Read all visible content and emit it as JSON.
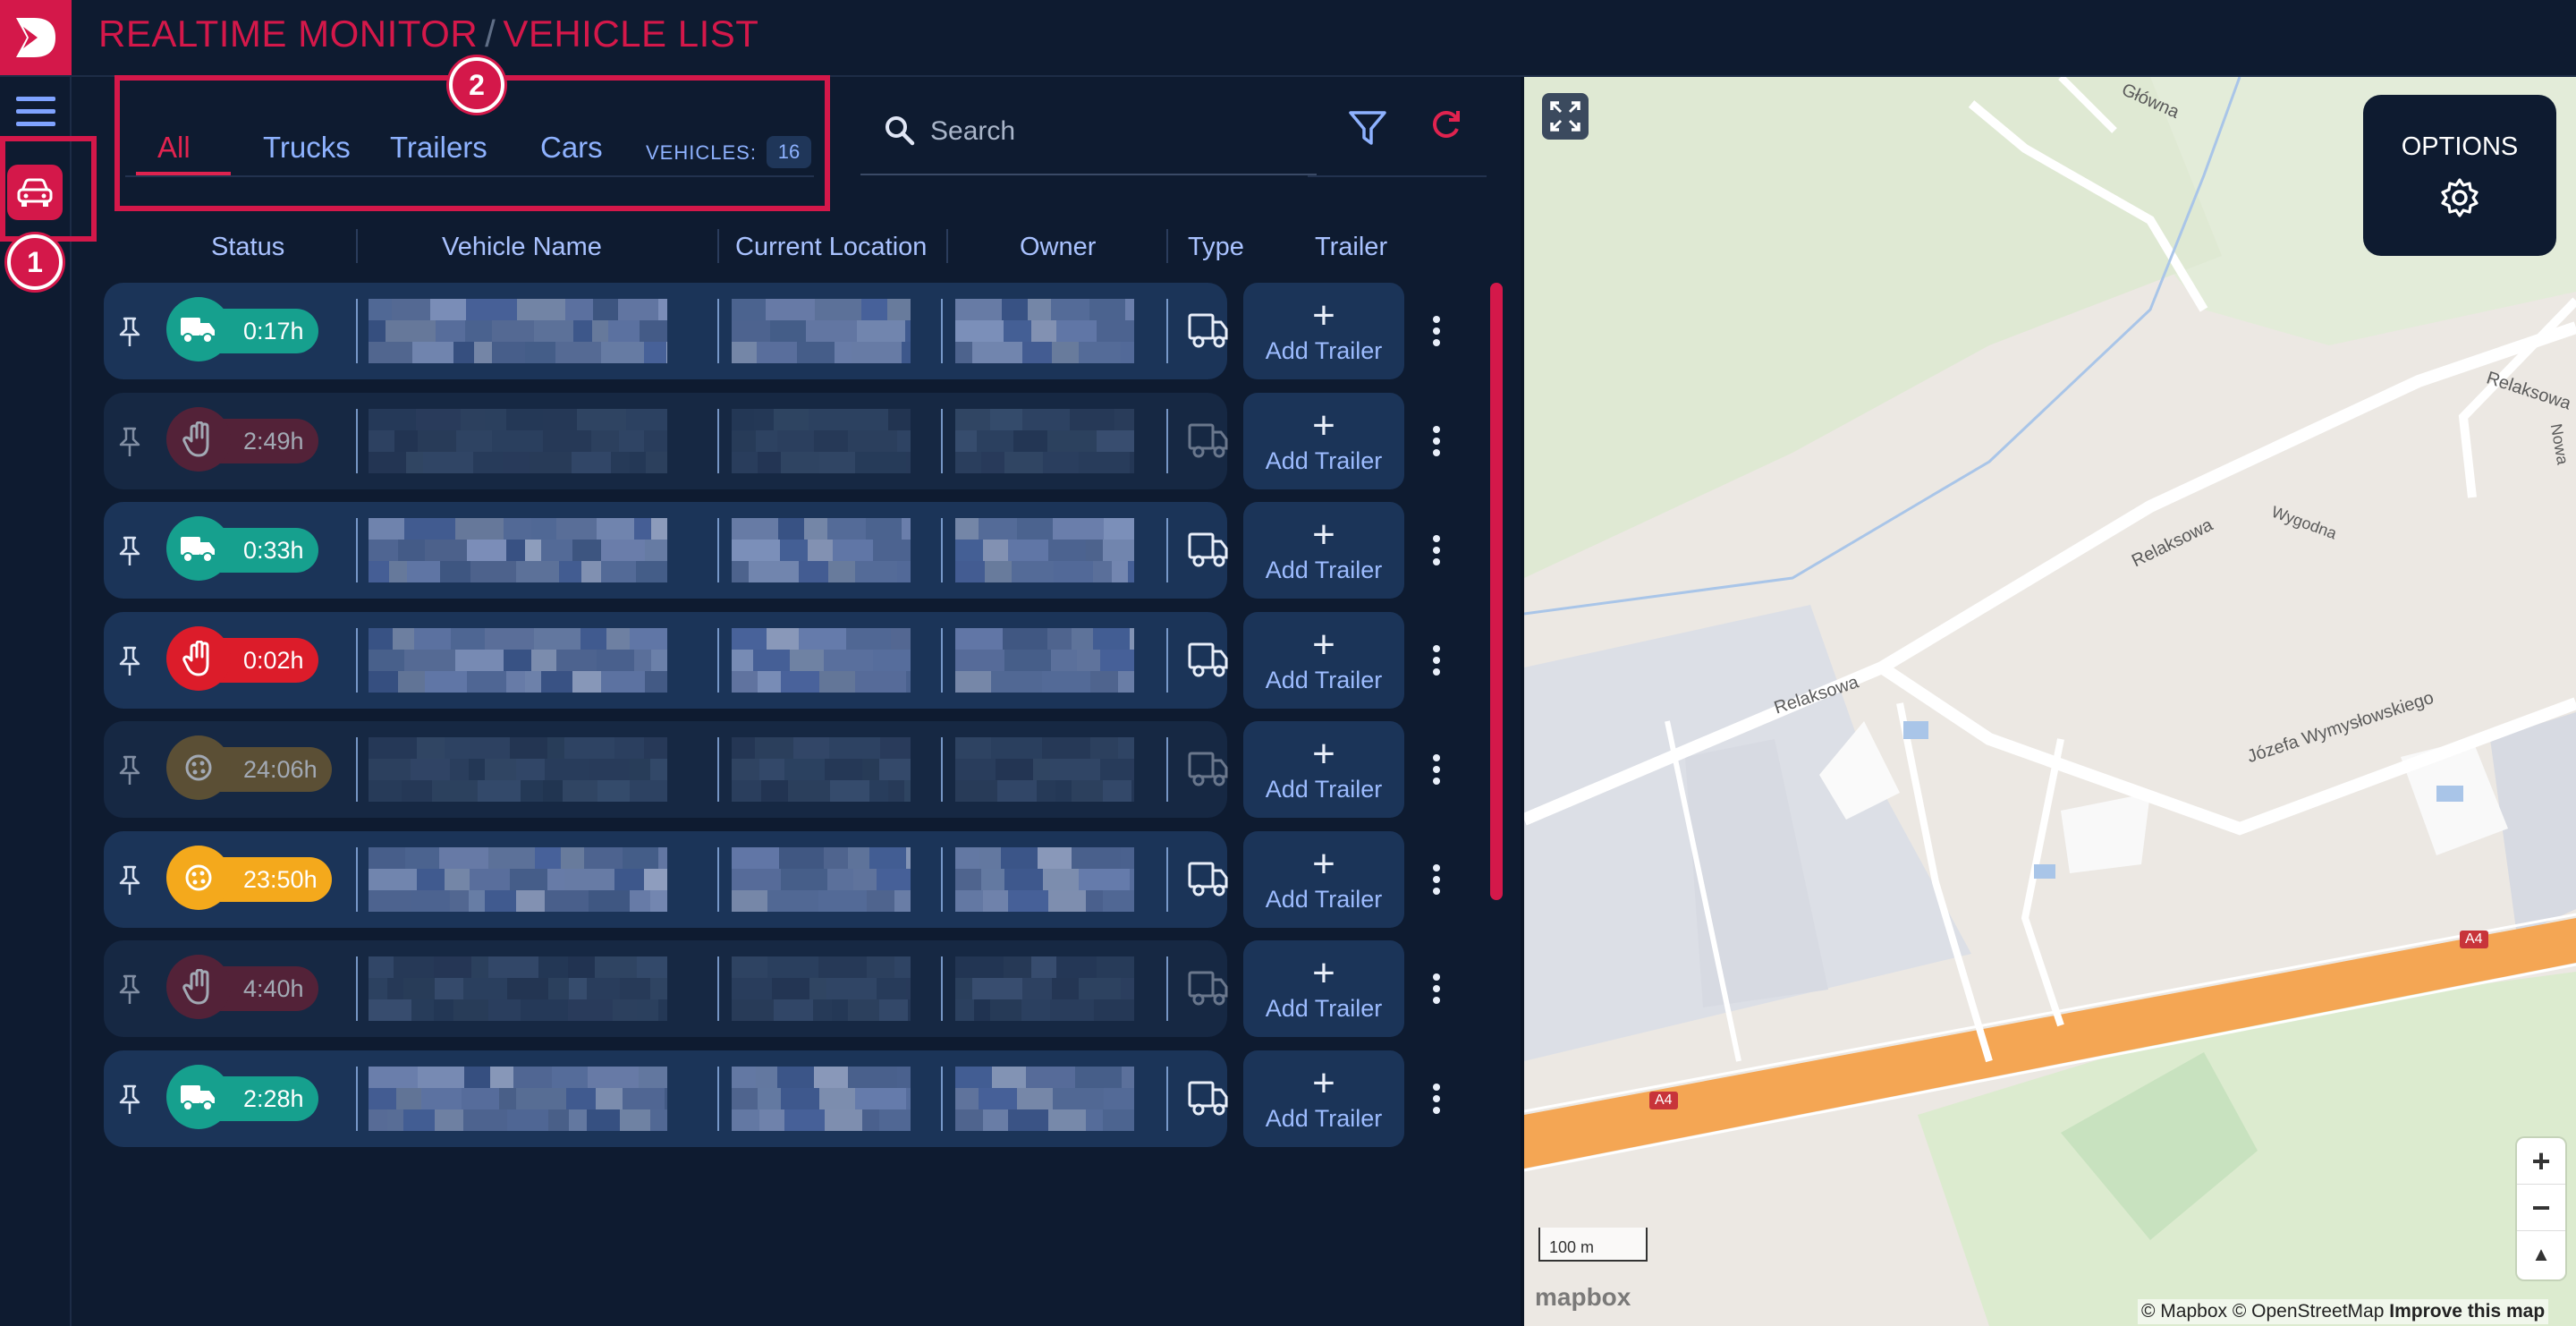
{
  "header": {
    "title_part1": "REALTIME MONITOR",
    "separator": "/",
    "title_part2": "VEHICLE LIST"
  },
  "annotations": {
    "badge1": "1",
    "badge2": "2"
  },
  "tabs": [
    {
      "label": "All",
      "active": true
    },
    {
      "label": "Trucks"
    },
    {
      "label": "Trailers"
    },
    {
      "label": "Cars"
    }
  ],
  "vehicles_label": "VEHICLES:",
  "vehicles_count": "16",
  "search": {
    "placeholder": "Search",
    "value": ""
  },
  "columns": {
    "status": "Status",
    "vehicle_name": "Vehicle Name",
    "current_location": "Current Location",
    "owner": "Owner",
    "type": "Type",
    "trailer": "Trailer"
  },
  "rows": [
    {
      "status": "driving",
      "time": "0:17h",
      "color": "#16a08e",
      "dim": false
    },
    {
      "status": "stopped",
      "time": "2:49h",
      "color": "#7d1f31",
      "dim": true
    },
    {
      "status": "driving",
      "time": "0:33h",
      "color": "#16a08e",
      "dim": false
    },
    {
      "status": "stopped",
      "time": "0:02h",
      "color": "#dc1c2a",
      "dim": false
    },
    {
      "status": "resting",
      "time": "24:06h",
      "color": "#8a6a2c",
      "dim": true
    },
    {
      "status": "resting",
      "time": "23:50h",
      "color": "#f4a91c",
      "dim": false
    },
    {
      "status": "stopped",
      "time": "4:40h",
      "color": "#7d1f31",
      "dim": true
    },
    {
      "status": "driving",
      "time": "2:28h",
      "color": "#16a08e",
      "dim": false
    }
  ],
  "add_trailer_label": "Add Trailer",
  "add_trailer_plus": "+",
  "map": {
    "options_label": "OPTIONS",
    "scale": "100 m",
    "zoom_in": "+",
    "zoom_out": "−",
    "compass": "▲",
    "logo": "mapbox",
    "attribution": "© Mapbox © OpenStreetMap",
    "improve": "Improve this map",
    "labels": {
      "glowna": "Główna",
      "relaksowa_top": "Relaksowa",
      "relaksowa_mid": "Relaksowa",
      "relaksowa_left": "Relaksowa",
      "wygodna": "Wygodna",
      "jozefa": "Józefa Wymysłowskiego",
      "nowa": "Nowa",
      "a4_left": "A4",
      "a4_right": "A4"
    }
  },
  "colors": {
    "accent": "#d4184a",
    "background": "#0e1b30",
    "row": "#1b3458",
    "tab_text": "#8eb2ff"
  }
}
